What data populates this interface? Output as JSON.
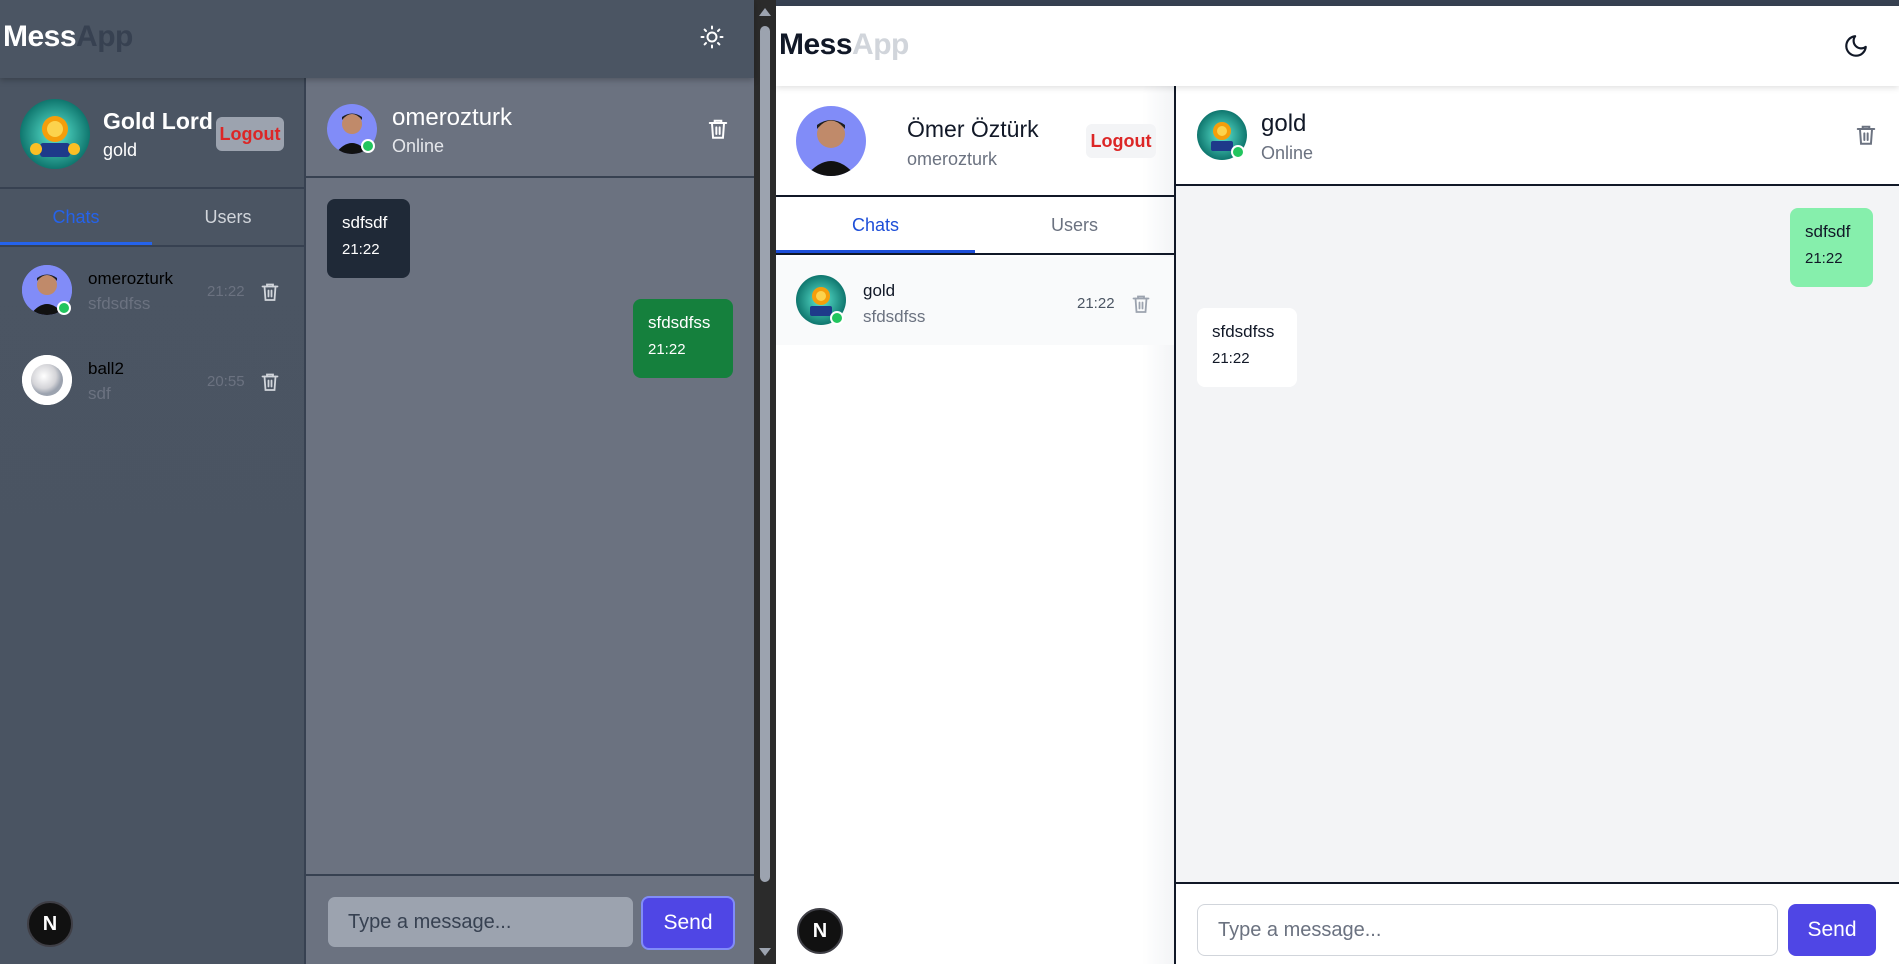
{
  "brand": {
    "part1": "Mess",
    "part2": "App"
  },
  "dark": {
    "profile": {
      "name": "Gold Lord",
      "username": "gold",
      "logout": "Logout"
    },
    "tabs": [
      "Chats",
      "Users"
    ],
    "chats": [
      {
        "name": "omerozturk",
        "last": "sfdsdfss",
        "time": "21:22",
        "online": true
      },
      {
        "name": "ball2",
        "last": "sdf",
        "time": "20:55",
        "online": false
      }
    ],
    "header": {
      "name": "omerozturk",
      "status": "Online"
    },
    "messages": [
      {
        "text": "sdfsdf",
        "time": "21:22",
        "side": "left"
      },
      {
        "text": "sfdsdfss",
        "time": "21:22",
        "side": "right"
      }
    ],
    "composer": {
      "placeholder": "Type a message...",
      "send": "Send"
    },
    "badge": "N",
    "colors": {
      "accent": "#2563eb",
      "sent_bubble": "#15803d",
      "received_bubble": "#1f2937",
      "logout_text": "#dc2626"
    }
  },
  "light": {
    "profile": {
      "name": "Ömer Öztürk",
      "username": "omerozturk",
      "logout": "Logout"
    },
    "tabs": [
      "Chats",
      "Users"
    ],
    "chats": [
      {
        "name": "gold",
        "last": "sfdsdfss",
        "time": "21:22",
        "online": true
      }
    ],
    "header": {
      "name": "gold",
      "status": "Online"
    },
    "messages": [
      {
        "text": "sdfsdf",
        "time": "21:22",
        "side": "right"
      },
      {
        "text": "sfdsdfss",
        "time": "21:22",
        "side": "left"
      }
    ],
    "composer": {
      "placeholder": "Type a message...",
      "send": "Send"
    },
    "badge": "N",
    "colors": {
      "accent": "#1d4ed8",
      "sent_bubble": "#86efac",
      "received_bubble": "#ffffff",
      "send_button": "#4f46e5"
    }
  },
  "icons": {
    "dark_theme_toggle": "sun-icon",
    "light_theme_toggle": "moon-icon",
    "delete": "trash-icon"
  }
}
